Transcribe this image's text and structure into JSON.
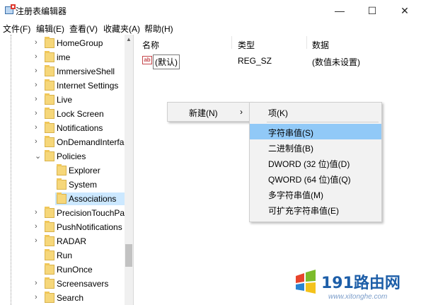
{
  "window": {
    "title": "注册表编辑器",
    "minimize_glyph": "—",
    "maximize_glyph": "☐",
    "close_glyph": "✕"
  },
  "menu": [
    "文件(F)",
    "编辑(E)",
    "查看(V)",
    "收藏夹(A)",
    "帮助(H)"
  ],
  "tree": [
    {
      "label": "HomeGroup",
      "expander": "›",
      "depth": 0
    },
    {
      "label": "ime",
      "expander": "›",
      "depth": 0
    },
    {
      "label": "ImmersiveShell",
      "expander": "›",
      "depth": 0
    },
    {
      "label": "Internet Settings",
      "expander": "›",
      "depth": 0
    },
    {
      "label": "Live",
      "expander": "›",
      "depth": 0
    },
    {
      "label": "Lock Screen",
      "expander": "›",
      "depth": 0
    },
    {
      "label": "Notifications",
      "expander": "›",
      "depth": 0
    },
    {
      "label": "OnDemandInterfac",
      "expander": "›",
      "depth": 0
    },
    {
      "label": "Policies",
      "expander": "⌄",
      "depth": 0
    },
    {
      "label": "Explorer",
      "expander": "",
      "depth": 1
    },
    {
      "label": "System",
      "expander": "",
      "depth": 1
    },
    {
      "label": "Associations",
      "expander": "",
      "depth": 1,
      "selected": true
    },
    {
      "label": "PrecisionTouchPac",
      "expander": "›",
      "depth": 0
    },
    {
      "label": "PushNotifications",
      "expander": "›",
      "depth": 0
    },
    {
      "label": "RADAR",
      "expander": "›",
      "depth": 0
    },
    {
      "label": "Run",
      "expander": "",
      "depth": 0
    },
    {
      "label": "RunOnce",
      "expander": "",
      "depth": 0
    },
    {
      "label": "Screensavers",
      "expander": "›",
      "depth": 0
    },
    {
      "label": "Search",
      "expander": "›",
      "depth": 0
    }
  ],
  "list": {
    "headers": {
      "name": "名称",
      "type": "类型",
      "data": "数据"
    },
    "rows": [
      {
        "icon": "ab",
        "name": "(默认)",
        "type": "REG_SZ",
        "data": "(数值未设置)"
      }
    ]
  },
  "context_menu": {
    "new_label": "新建(N)",
    "new_arrow": "›"
  },
  "submenu": {
    "items": [
      {
        "label": "项(K)"
      },
      {
        "label": "字符串值(S)",
        "highlighted": true
      },
      {
        "label": "二进制值(B)"
      },
      {
        "label": "DWORD (32 位)值(D)"
      },
      {
        "label": "QWORD (64 位)值(Q)"
      },
      {
        "label": "多字符串值(M)"
      },
      {
        "label": "可扩充字符串值(E)"
      }
    ]
  },
  "watermark": {
    "brand": "191路由网",
    "url": "www.xitonghe.com"
  },
  "colors": {
    "selection": "#cce8ff",
    "menu_highlight": "#91c9f7",
    "folder": "#f6d77a"
  }
}
